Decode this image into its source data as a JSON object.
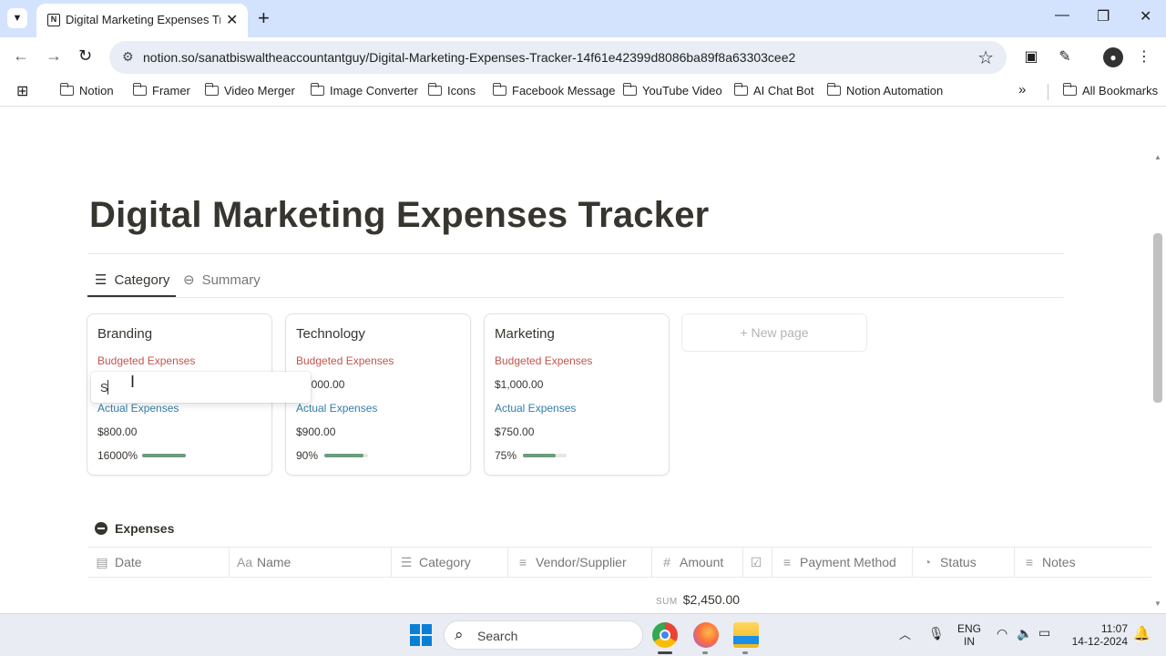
{
  "browser": {
    "tab_title": "Digital Marketing Expenses Trac",
    "tab_favicon": "N",
    "url": "notion.so/sanatbiswaltheaccountantguy/Digital-Marketing-Expenses-Tracker-14f61e42399d8086ba89f8a63303cee2",
    "bookmarks": [
      "Notion",
      "Framer",
      "Video Merger",
      "Image Converter",
      "Icons",
      "Facebook Message",
      "YouTube Video",
      "AI Chat Bot",
      "Notion Automation"
    ],
    "all_bookmarks": "All Bookmarks",
    "more_bookmarks": "»"
  },
  "page": {
    "title": "Digital Marketing Expenses Tracker",
    "views": [
      {
        "label": "Category",
        "icon": "list-icon",
        "active": true
      },
      {
        "label": "Summary",
        "icon": "summary-icon",
        "active": false
      }
    ],
    "cards": [
      {
        "name": "Branding",
        "budget_label": "Budgeted Expenses",
        "budget_value": "",
        "actual_label": "Actual Expenses",
        "actual_value": "$800.00",
        "percent": "16000%",
        "progress": 1.0
      },
      {
        "name": "Technology",
        "budget_label": "Budgeted Expenses",
        "budget_value": "$1,000.00",
        "actual_label": "Actual Expenses",
        "actual_value": "$900.00",
        "percent": "90%",
        "progress": 0.9
      },
      {
        "name": "Marketing",
        "budget_label": "Budgeted Expenses",
        "budget_value": "$1,000.00",
        "actual_label": "Actual Expenses",
        "actual_value": "$750.00",
        "percent": "75%",
        "progress": 0.75
      }
    ],
    "new_page": "New page",
    "edit_value": "S",
    "database": {
      "title": "Expenses",
      "columns": [
        {
          "label": "Date",
          "icon": "calendar-icon"
        },
        {
          "label": "Name",
          "icon": "text-icon"
        },
        {
          "label": "Category",
          "icon": "list-icon"
        },
        {
          "label": "Vendor/Supplier",
          "icon": "text-lines-icon"
        },
        {
          "label": "Amount",
          "icon": "number-icon"
        },
        {
          "label": "",
          "icon": "checkbox-icon"
        },
        {
          "label": "Payment Method",
          "icon": "text-lines-icon"
        },
        {
          "label": "Status",
          "icon": "status-icon"
        },
        {
          "label": "Notes",
          "icon": "text-lines-icon"
        }
      ],
      "sum_label": "SUM",
      "sum_value": "$2,450.00"
    }
  },
  "taskbar": {
    "search_placeholder": "Search",
    "lang_top": "ENG",
    "lang_bottom": "IN",
    "time": "11:07",
    "date": "14-12-2024"
  }
}
